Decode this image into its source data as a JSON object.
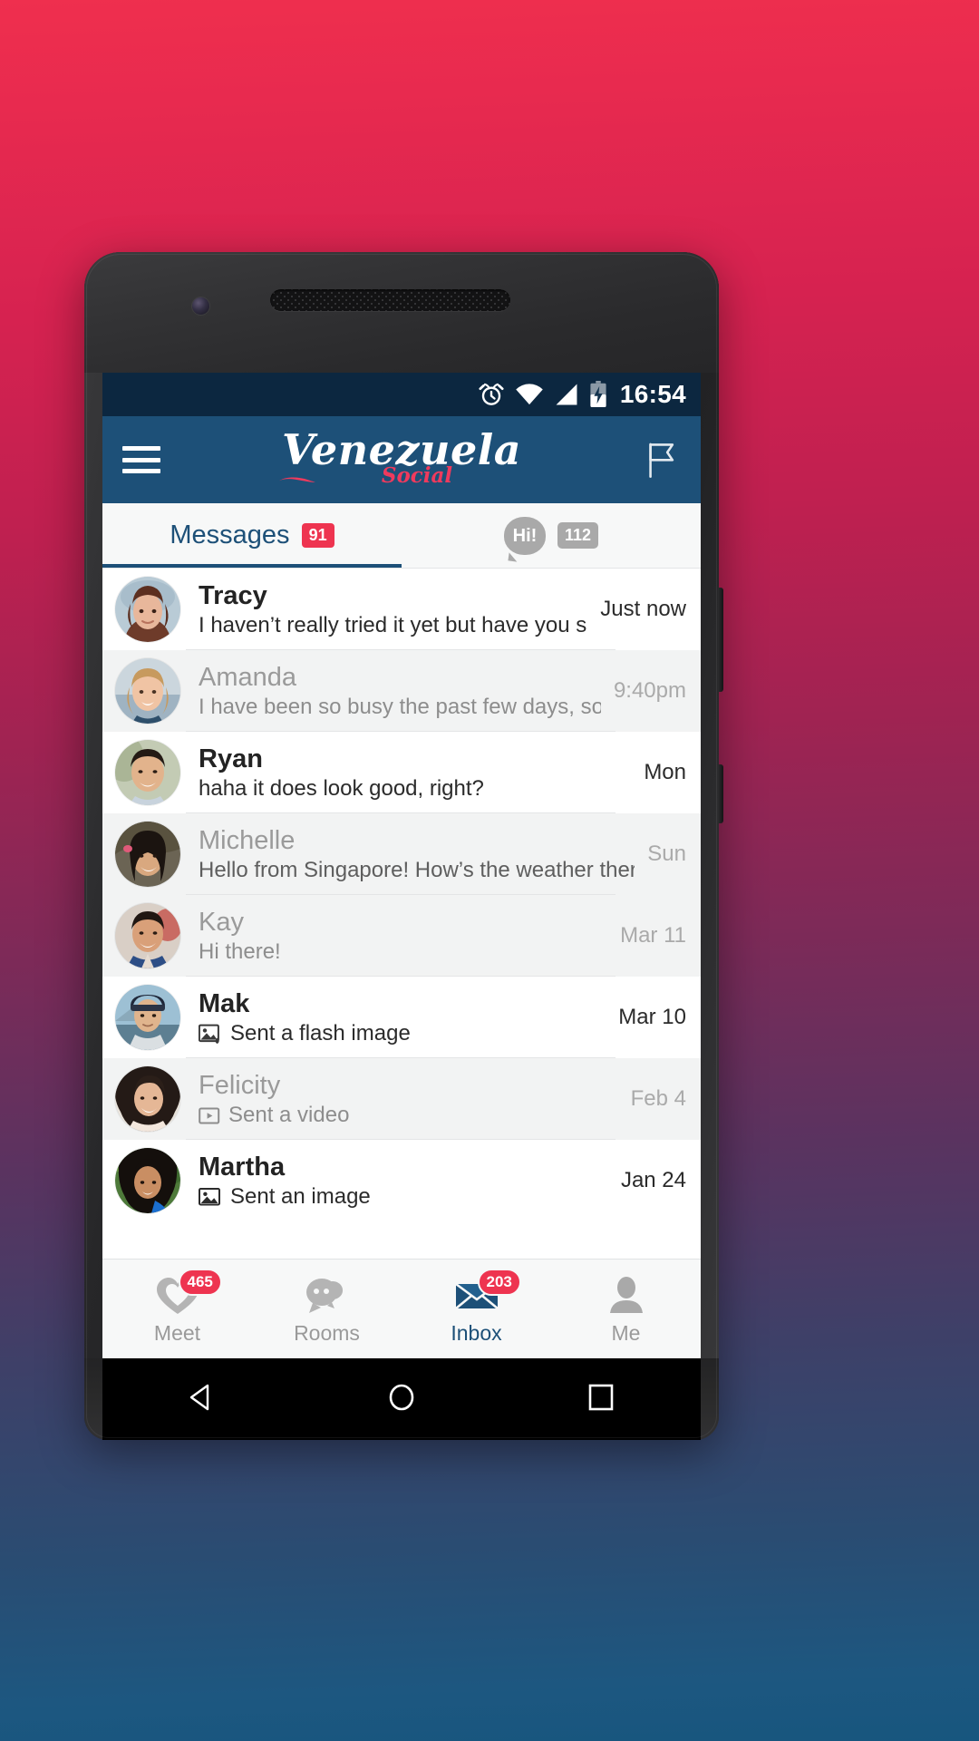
{
  "statusbar": {
    "time": "16:54",
    "icons": [
      "alarm-icon",
      "wifi-icon",
      "cellular-signal-icon",
      "battery-charging-icon"
    ]
  },
  "appbar": {
    "menu_icon": "hamburger-menu-icon",
    "brand_main": "Venezuela",
    "brand_sub": "Social",
    "flag_icon": "flag-icon",
    "brand_color": "#ef3a5d",
    "bar_color": "#1d5078"
  },
  "tabs": [
    {
      "label": "Messages",
      "badge": "91",
      "active": true
    },
    {
      "icon": "speech-bubble-icon",
      "bubble_text": "Hi!",
      "badge": "112",
      "active": false
    }
  ],
  "messages": [
    {
      "name": "Tracy",
      "preview": "I haven’t really tried it yet but have you seen th...",
      "time": "Just now",
      "state": "unread",
      "attachment": ""
    },
    {
      "name": "Amanda",
      "preview": "I have been so busy the past few days, sorry if i...",
      "time": "9:40pm",
      "state": "read",
      "attachment": ""
    },
    {
      "name": "Ryan",
      "preview": "haha it does look good, right?",
      "time": "Mon",
      "state": "unread",
      "attachment": ""
    },
    {
      "name": "Michelle",
      "preview": "Hello from Singapore! How’s the weather there?",
      "time": "Sun",
      "state": "mixed",
      "attachment": ""
    },
    {
      "name": "Kay",
      "preview": "Hi there!",
      "time": "Mar 11",
      "state": "read",
      "attachment": ""
    },
    {
      "name": "Mak",
      "preview": "Sent a flash image",
      "time": "Mar 10",
      "state": "unread",
      "attachment": "flash-image-icon"
    },
    {
      "name": "Felicity",
      "preview": "Sent a video",
      "time": "Feb 4",
      "state": "read",
      "attachment": "video-icon"
    },
    {
      "name": "Martha",
      "preview": "Sent an image",
      "time": "Jan 24",
      "state": "unread",
      "attachment": "image-icon"
    }
  ],
  "bottomnav": [
    {
      "label": "Meet",
      "icon": "heart-icon",
      "badge": "465",
      "active": false
    },
    {
      "label": "Rooms",
      "icon": "chat-bubbles-icon",
      "badge": "",
      "active": false
    },
    {
      "label": "Inbox",
      "icon": "envelope-icon",
      "badge": "203",
      "active": true
    },
    {
      "label": "Me",
      "icon": "person-icon",
      "badge": "",
      "active": false
    }
  ],
  "androidnav": {
    "back": "back-triangle-icon",
    "home": "home-circle-icon",
    "recents": "recents-square-icon"
  }
}
